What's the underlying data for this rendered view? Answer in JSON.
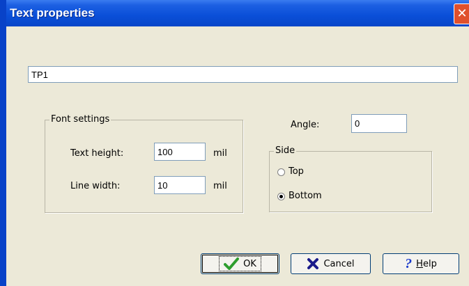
{
  "window": {
    "title": "Text properties",
    "close_icon": "close-icon"
  },
  "text_value": "TP1",
  "font_settings": {
    "legend": "Font settings",
    "text_height_label": "Text height:",
    "text_height_value": "100",
    "text_height_unit": "mil",
    "line_width_label": "Line width:",
    "line_width_value": "10",
    "line_width_unit": "mil"
  },
  "angle": {
    "label": "Angle:",
    "value": "0"
  },
  "side": {
    "legend": "Side",
    "options": [
      {
        "label": "Top",
        "checked": false
      },
      {
        "label": "Bottom",
        "checked": true
      }
    ]
  },
  "buttons": {
    "ok_label": "OK",
    "cancel_label": "Cancel",
    "help_label": "Help"
  },
  "colors": {
    "title_bar": "#0a4fd8",
    "close_button": "#e0502c",
    "dialog_bg": "#ece9d8",
    "ok_check": "#2e9e2e",
    "cancel_x": "#1a1a8a",
    "help_q": "#1a3acc"
  }
}
